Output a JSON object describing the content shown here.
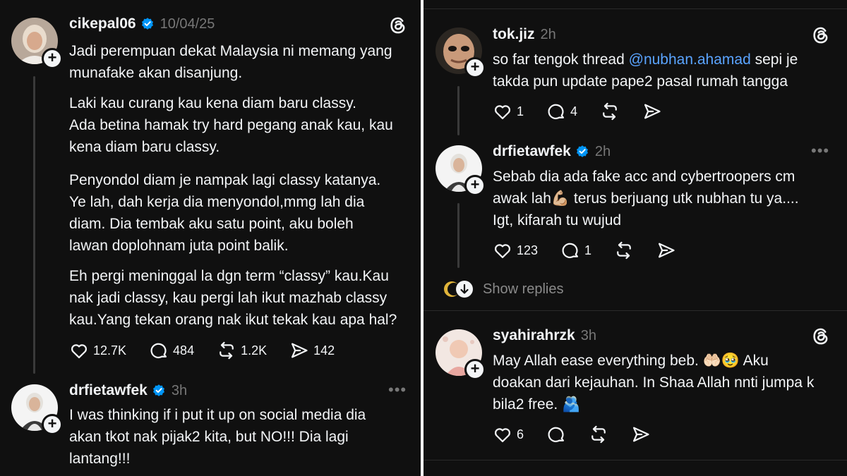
{
  "left": {
    "post1": {
      "username": "cikepal06",
      "time": "10/04/25",
      "paragraphs": [
        "Jadi perempuan dekat Malaysia ni memang yang\nmunafake akan disanjung.",
        "Laki kau curang kau kena diam baru classy.\nAda betina hamak try hard pegang anak kau, kau\nkena diam baru classy.",
        "Penyondol diam je nampak lagi classy katanya.\nYe lah, dah kerja dia menyondol,mmg lah dia\ndiam. Dia tembak aku satu point, aku boleh\nlawan doplohnam juta point balik.",
        "Eh pergi meninggal la dgn term “classy” kau.Kau\nnak jadi classy, kau pergi lah ikut mazhab classy\nkau.Yang tekan orang nak ikut tekak kau apa hal?"
      ],
      "likes": "12.7K",
      "replies": "484",
      "reposts": "1.2K",
      "shares": "142"
    },
    "post2": {
      "username": "drfietawfek",
      "time": "3h",
      "more": "•••",
      "text": "I was thinking if i put it up on social media dia\nakan tkot nak pijak2 kita, but NO!!! Dia lagi\nlantang!!!"
    }
  },
  "right": {
    "post1": {
      "username": "tok.jiz",
      "time": "2h",
      "text_before": "so far tengok thread ",
      "mention": "@nubhan.ahamad",
      "text_after": " sepi je\ntakda pun update pape2 pasal rumah tangga",
      "likes": "1",
      "replies": "4"
    },
    "post2": {
      "username": "drfietawfek",
      "time": "2h",
      "more": "•••",
      "text": "Sebab dia ada fake acc and cybertroopers cm\nawak lah💪🏼 terus berjuang utk nubhan tu ya....\nIgt, kifarah tu wujud",
      "likes": "123",
      "replies": "1"
    },
    "show_replies": "Show replies",
    "post3": {
      "username": "syahirahrzk",
      "time": "3h",
      "text": "May Allah ease everything beb. 🤲🏻🥹 Aku\ndoakan dari kejauhan. In Shaa Allah nnti jumpa k\nbila2 free. 🫂",
      "likes": "6"
    }
  },
  "colors": {
    "background": "#101010",
    "text": "#f3f5f7",
    "muted": "#777777",
    "mention": "#5aa4ff",
    "verified": "#0095f6"
  },
  "icons": [
    "threads-logo-icon",
    "verified-badge-icon",
    "heart-icon",
    "comment-icon",
    "repost-icon",
    "share-icon",
    "plus-icon",
    "more-options-icon",
    "chevron-down-icon"
  ]
}
